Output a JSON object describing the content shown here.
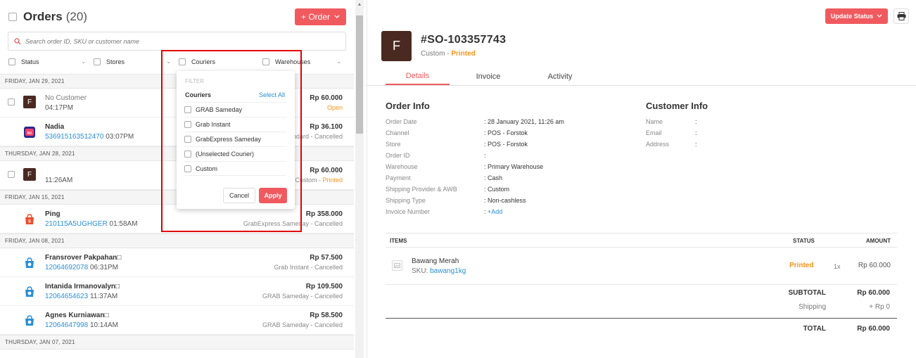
{
  "colors": {
    "accent": "#f05a5f",
    "link": "#2a8fd4",
    "warning": "#f7941d",
    "avatar_bg": "#4a2a20",
    "highlight_box": "#e00000"
  },
  "orders_panel": {
    "title": "Orders",
    "count": "(20)",
    "add_button": "+ Order",
    "search_placeholder": "Search order ID, SKU or customer name",
    "filters": [
      "Status",
      "Stores",
      "Couriers",
      "Warehouses"
    ]
  },
  "groups": [
    {
      "date": "FRIDAY, JAN 29, 2021",
      "orders": [
        {
          "icon": "avatar",
          "avatar_letter": "F",
          "name": "No Customer",
          "name_muted": true,
          "order_id": "",
          "time": "04:17PM",
          "amount": "Rp 60.000",
          "courier": "",
          "status": "Open",
          "status_color": "warning",
          "checkbox": true
        },
        {
          "icon": "lazada-icon",
          "name": "Nadia",
          "order_id": "536915163512470",
          "time": "03:07PM",
          "amount": "Rp 36.100",
          "courier": "ndard",
          "status": "Cancelled",
          "status_color": "muted",
          "checkbox": false
        }
      ]
    },
    {
      "date": "THURSDAY, JAN 28, 2021",
      "orders": [
        {
          "icon": "avatar",
          "avatar_letter": "F",
          "name": "",
          "order_id": "",
          "time": "11:26AM",
          "amount": "Rp 60.000",
          "courier": "Custom",
          "status": "Printed",
          "status_color": "warning",
          "checkbox": true
        }
      ]
    },
    {
      "date": "FRIDAY, JAN 15, 2021",
      "orders": [
        {
          "icon": "shopee-icon",
          "name": "Ping",
          "order_id": "210115A5UGHGER",
          "time": "01:58AM",
          "amount": "Rp 358.000",
          "courier": "GrabExpress Sameday",
          "status": "Cancelled",
          "status_color": "muted",
          "checkbox": false
        }
      ]
    },
    {
      "date": "FRIDAY, JAN 08, 2021",
      "orders": [
        {
          "icon": "blibli-icon",
          "name": "Fransrover Pakpahan□",
          "order_id": "12064692078",
          "time": "06:31PM",
          "amount": "Rp 57.500",
          "courier": "Grab Instant",
          "status": "Cancelled",
          "status_color": "muted",
          "checkbox": false
        },
        {
          "icon": "blibli-icon",
          "name": "Intanida Irmanovalyn□",
          "order_id": "12064654623",
          "time": "11:37AM",
          "amount": "Rp 109.500",
          "courier": "GRAB Sameday",
          "status": "Cancelled",
          "status_color": "muted",
          "checkbox": false
        },
        {
          "icon": "blibli-icon",
          "name": "Agnes Kurniawan□",
          "order_id": "12064647998",
          "time": "10:14AM",
          "amount": "Rp 58.500",
          "courier": "GRAB Sameday",
          "status": "Cancelled",
          "status_color": "muted",
          "checkbox": false
        }
      ]
    },
    {
      "date": "THURSDAY, JAN 07, 2021",
      "orders": []
    }
  ],
  "courier_filter": {
    "header": "FILTER",
    "title": "Couriers",
    "select_all": "Select All",
    "options": [
      "GRAB Sameday",
      "Grab Instant",
      "GrabExpress Sameday",
      "(Unselected Courier)",
      "Custom"
    ],
    "cancel": "Cancel",
    "apply": "Apply"
  },
  "detail": {
    "update_status": "Update Status",
    "avatar_letter": "F",
    "order_number": "#SO-103357743",
    "channel_label": "Custom",
    "separator": " - ",
    "status": "Printed",
    "tabs": [
      "Details",
      "Invoice",
      "Activity"
    ],
    "order_info": {
      "title": "Order Info",
      "rows": [
        {
          "k": "Order Date",
          "v": ": 28 January 2021, 11:26 am"
        },
        {
          "k": "Channel",
          "v": ": POS - Forstok"
        },
        {
          "k": "Store",
          "v": ": POS - Forstok"
        },
        {
          "k": "Order ID",
          "v": ":"
        },
        {
          "k": "Warehouse",
          "v": ": Primary Warehouse"
        },
        {
          "k": "Payment",
          "v": ": Cash"
        },
        {
          "k": "Shipping Provider & AWB",
          "v": ": Custom"
        },
        {
          "k": "Shipping Type",
          "v": ": Non-cashless"
        },
        {
          "k": "Invoice Number",
          "v": ":",
          "link": "+Add"
        }
      ]
    },
    "customer_info": {
      "title": "Customer Info",
      "rows": [
        {
          "k": "Name",
          "v": ":"
        },
        {
          "k": "Email",
          "v": ":"
        },
        {
          "k": "Address",
          "v": ":"
        }
      ]
    },
    "items": {
      "headers": {
        "items": "ITEMS",
        "status": "STATUS",
        "amount": "AMOUNT"
      },
      "rows": [
        {
          "name": "Bawang Merah",
          "sku_label": "SKU:",
          "sku": "bawang1kg",
          "status": "Printed",
          "qty": "1x",
          "amount": "Rp 60.000"
        }
      ],
      "subtotal_label": "SUBTOTAL",
      "subtotal": "Rp 60.000",
      "shipping_label": "Shipping",
      "shipping": "+ Rp 0",
      "total_label": "TOTAL",
      "total": "Rp 60.000"
    }
  }
}
